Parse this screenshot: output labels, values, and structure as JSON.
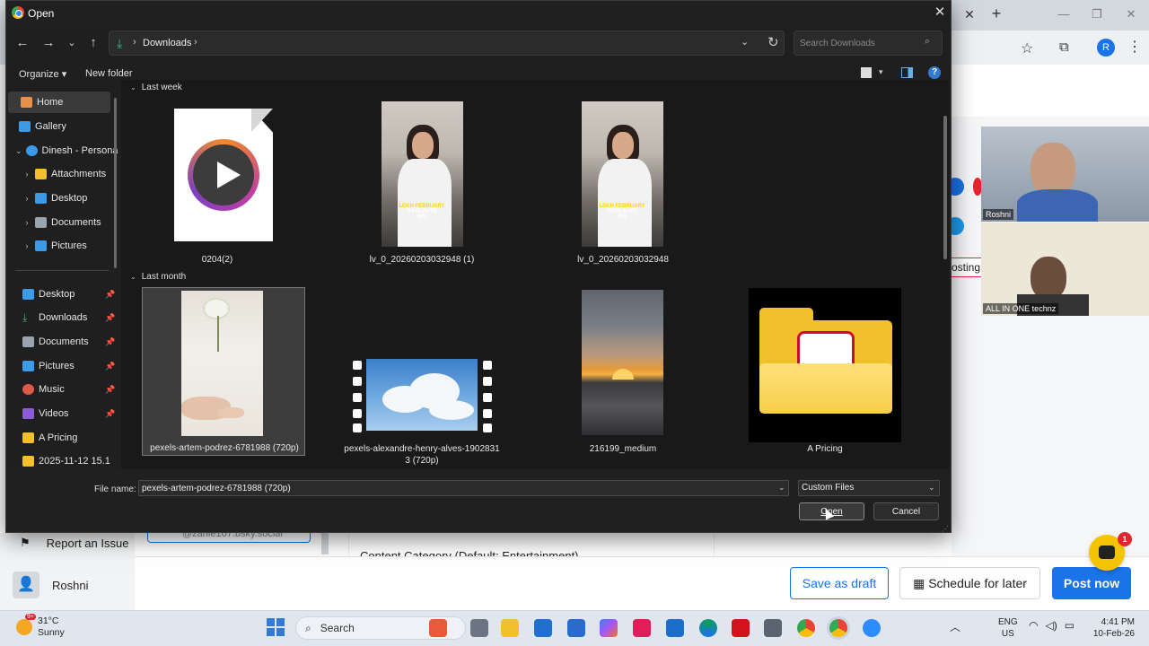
{
  "dialog": {
    "title": "Open",
    "address": {
      "folder": "Downloads"
    },
    "search": {
      "placeholder": "Search Downloads"
    },
    "command_bar": {
      "organize": "Organize ▾",
      "new_folder": "New folder"
    },
    "nav_pane": {
      "items": [
        {
          "label": "Home"
        },
        {
          "label": "Gallery"
        },
        {
          "label": "Dinesh - Persona"
        },
        {
          "label": "Attachments"
        },
        {
          "label": "Desktop"
        },
        {
          "label": "Documents"
        },
        {
          "label": "Pictures"
        },
        {
          "label": "Desktop"
        },
        {
          "label": "Downloads"
        },
        {
          "label": "Documents"
        },
        {
          "label": "Pictures"
        },
        {
          "label": "Music"
        },
        {
          "label": "Videos"
        },
        {
          "label": "A Pricing"
        },
        {
          "label": "2025-11-12 15.1"
        }
      ]
    },
    "groups": [
      {
        "header": "Last week",
        "files": [
          {
            "name": "0204(2)",
            "thumb": "media-player-file-icon"
          },
          {
            "name": "lv_0_20260203032948 (1)",
            "thumb": "video-photo-woman"
          },
          {
            "name": "lv_0_20260203032948",
            "thumb": "video-photo-woman"
          }
        ]
      },
      {
        "header": "Last month",
        "files": [
          {
            "name": "pexels-artem-podrez-6781988 (720p)",
            "thumb": "photo-hand-flower",
            "selected": true
          },
          {
            "name": "pexels-alexandre-henry-alves-1902831",
            "name_line2": "3 (720p)",
            "thumb": "film-clouds"
          },
          {
            "name": "216199_medium",
            "thumb": "photo-sunset"
          },
          {
            "name": "A Pricing",
            "thumb": "folder-pdf"
          }
        ]
      }
    ],
    "thumb_caption": {
      "line1": "LEKH FEBRUARY",
      "line2": "RATE RATE",
      "line3": "WO"
    },
    "file_name_label": "File name:",
    "file_name_value": "pexels-artem-podrez-6781988 (720p)",
    "filter": "Custom Files",
    "open_label": "Open",
    "cancel_label": "Cancel"
  },
  "background": {
    "video_tiles": [
      {
        "name": "Roshni"
      },
      {
        "name": "ALL IN ONE technz"
      }
    ],
    "posting_chip": "osting",
    "report_issue": "Report an Issue",
    "user_name": "Roshni",
    "handle_chip": "@zahle107.bsky.social",
    "content_category": "Content Category (Default: Entertainment)",
    "buttons": {
      "save_draft": "Save as draft",
      "schedule": "Schedule for later",
      "post_now": "Post now"
    },
    "chat_badge": "1",
    "profile_initial": "R"
  },
  "taskbar": {
    "weather": {
      "temp": "31°C",
      "condition": "Sunny",
      "badge": "9+"
    },
    "search_label": "Search",
    "lang_line1": "ENG",
    "lang_line2": "US",
    "time": "4:41 PM",
    "date": "10-Feb-26"
  },
  "colors": {
    "accent": "#1a73e8",
    "dialog_bg": "#1f1f1f",
    "selected_tile": "#3d3d3d"
  }
}
